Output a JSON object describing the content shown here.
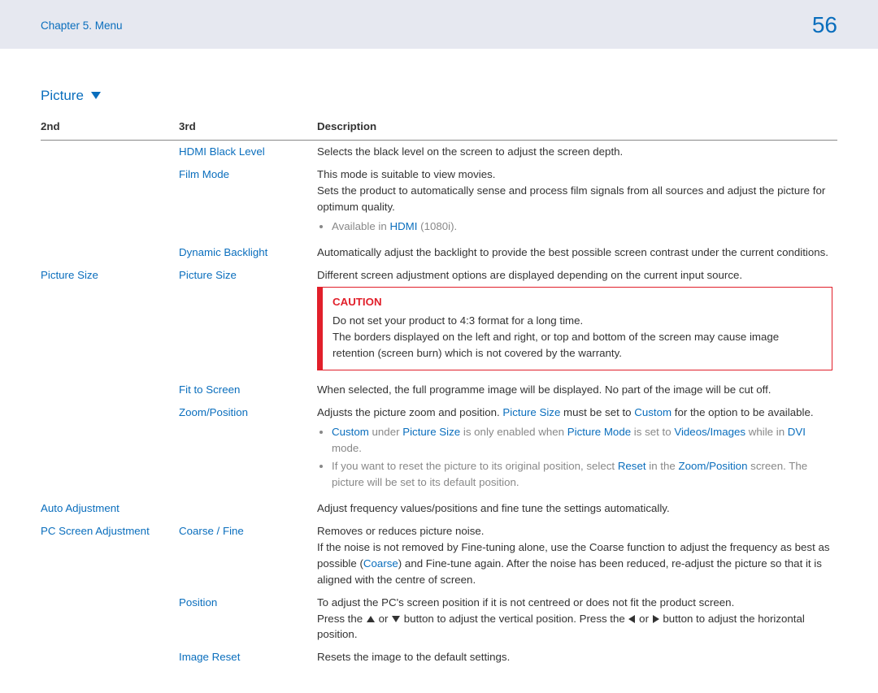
{
  "header": {
    "chapter": "Chapter 5. Menu",
    "page": "56"
  },
  "section": {
    "title": "Picture"
  },
  "columns": {
    "c1": "2nd",
    "c2": "3rd",
    "c3": "Description"
  },
  "rows": {
    "hdmi_black": {
      "third": "HDMI Black Level",
      "desc": "Selects the black level on the screen to adjust the screen depth."
    },
    "film_mode": {
      "third": "Film Mode",
      "desc_line1": "This mode is suitable to view movies.",
      "desc_line2": "Sets the product to automatically sense and process film signals from all sources and adjust the picture for optimum quality.",
      "note_pre": "Available in ",
      "note_hdmi": "HDMI",
      "note_post": " (1080i)."
    },
    "dyn_backlight": {
      "third": "Dynamic Backlight",
      "desc": "Automatically adjust the backlight to provide the best possible screen contrast under the current conditions."
    },
    "pic_size_group": {
      "second": "Picture Size",
      "third": "Picture Size",
      "desc": "Different screen adjustment options are displayed depending on the current input source.",
      "caution_title": "CAUTION",
      "caution_l1": "Do not set your product to 4:3 format for a long time.",
      "caution_l2": "The borders displayed on the left and right, or top and bottom of the screen may cause image retention (screen burn) which is not covered by the warranty."
    },
    "fit_screen": {
      "third": "Fit to Screen",
      "desc": "When selected, the full programme image will be displayed. No part of the image will be cut off."
    },
    "zoom_pos": {
      "third": "Zoom/Position",
      "desc_pre": "Adjusts the picture zoom and position. ",
      "desc_ps": "Picture Size",
      "desc_mid": " must be set to ",
      "desc_custom": "Custom",
      "desc_post": " for the option to be available.",
      "note1_custom": "Custom",
      "note1_a": " under ",
      "note1_ps": "Picture Size",
      "note1_b": " is only enabled when ",
      "note1_pm": "Picture Mode",
      "note1_c": " is set to ",
      "note1_vi": "Videos/Images",
      "note1_d": " while in ",
      "note1_dvi": "DVI",
      "note1_e": " mode.",
      "note2_a": "If you want to reset the picture to its original position, select ",
      "note2_reset": "Reset",
      "note2_b": " in the ",
      "note2_zp": "Zoom/Position",
      "note2_c": " screen. The picture will be set to its default position."
    },
    "auto_adj": {
      "second": "Auto Adjustment",
      "desc": "Adjust frequency values/positions and fine tune the settings automatically."
    },
    "pc_adj": {
      "second": "PC Screen Adjustment",
      "third": "Coarse / Fine",
      "desc_l1": "Removes or reduces picture noise.",
      "desc_l2a": "If the noise is not removed by Fine-tuning alone, use the Coarse function to adjust the frequency as best as possible (",
      "desc_coarse": "Coarse",
      "desc_l2b": ") and Fine-tune again. After the noise has been reduced, re-adjust the picture so that it is aligned with the centre of screen."
    },
    "position": {
      "third": "Position",
      "desc_l1": "To adjust the PC's screen position if it is not centreed or does not fit the product screen.",
      "desc_press1": "Press the ",
      "desc_or": " or ",
      "desc_mid": " button to adjust the vertical position. Press the ",
      "desc_end": " button to adjust the horizontal position."
    },
    "img_reset": {
      "third": "Image Reset",
      "desc": "Resets the image to the default settings."
    }
  }
}
